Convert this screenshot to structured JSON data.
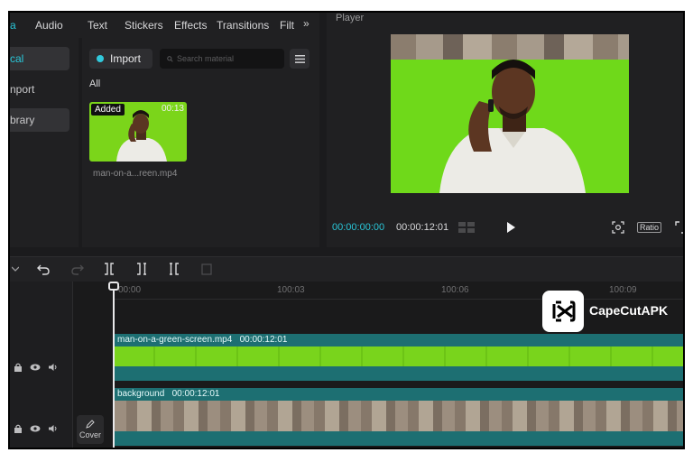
{
  "menu": {
    "items": [
      "a",
      "Audio",
      "Text",
      "Stickers",
      "Effects",
      "Transitions",
      "Filt"
    ],
    "more_icon": "chevron-double-right-icon"
  },
  "sidebar": {
    "items": [
      {
        "label": "cal",
        "state": "selected"
      },
      {
        "label": "nport",
        "state": "normal"
      },
      {
        "label": "brary",
        "state": "highlighted"
      }
    ]
  },
  "media": {
    "import_label": "Import",
    "search_placeholder": "Search material",
    "filter_label": "All",
    "clips": [
      {
        "badge": "Added",
        "duration": "00:13",
        "name": "man-on-a...reen.mp4"
      }
    ]
  },
  "player": {
    "title": "Player",
    "current_time": "00:00:00:00",
    "total_time": "00:00:12:01",
    "ratio_label": "Ratio"
  },
  "timeline": {
    "ruler_labels": [
      "00:00",
      "100:03",
      "100:06",
      "100:09"
    ],
    "tracks": [
      {
        "clip_name": "man-on-a-green-screen.mp4",
        "clip_duration": "00:00:12:01",
        "kind": "video"
      },
      {
        "clip_name": "background",
        "clip_duration": "00:00:12:01",
        "kind": "image"
      }
    ],
    "cover_label": "Cover"
  },
  "watermark": {
    "brand": "CapeCutAPK",
    "icon": "capcut-logo-icon"
  },
  "colors": {
    "accent": "#29c7d9",
    "green_screen": "#6fd91a",
    "clip_teal": "#1d6f72"
  }
}
